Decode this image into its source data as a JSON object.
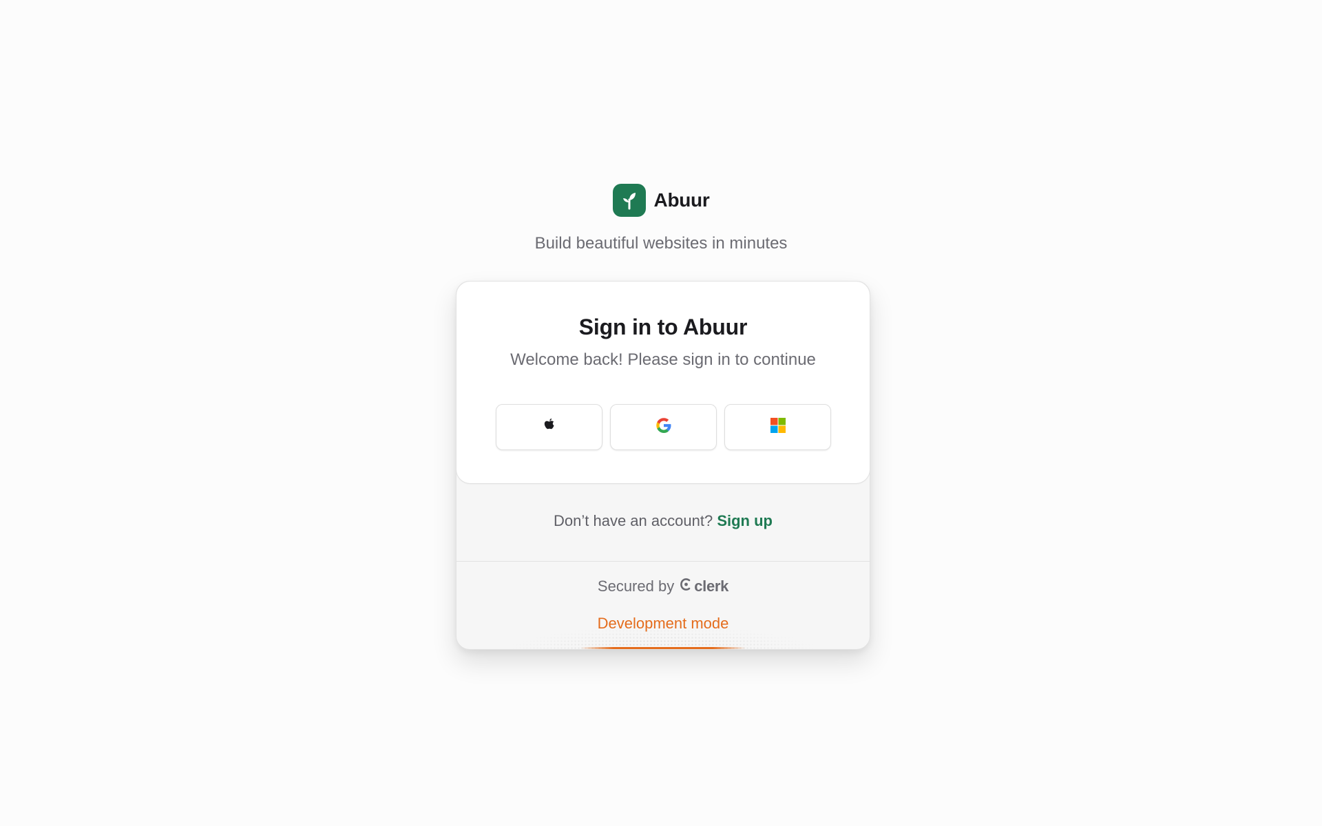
{
  "brand": {
    "name": "Abuur",
    "logo_icon": "sprout-icon",
    "logo_color": "#1f7a53"
  },
  "tagline": "Build beautiful websites in minutes",
  "card": {
    "title": "Sign in to Abuur",
    "subtitle": "Welcome back! Please sign in to continue",
    "social_buttons": [
      {
        "provider": "apple",
        "icon": "apple-icon"
      },
      {
        "provider": "google",
        "icon": "google-icon"
      },
      {
        "provider": "microsoft",
        "icon": "microsoft-icon"
      }
    ],
    "signup_prompt": "Don’t have an account?",
    "signup_link": "Sign up",
    "secured_by": "Secured by",
    "secured_brand": "clerk",
    "dev_mode": "Development mode"
  },
  "colors": {
    "accent": "#1f7a53",
    "dev_mode": "#e46c1c",
    "text_primary": "#1b1b1f",
    "text_secondary": "#6b6b72"
  }
}
